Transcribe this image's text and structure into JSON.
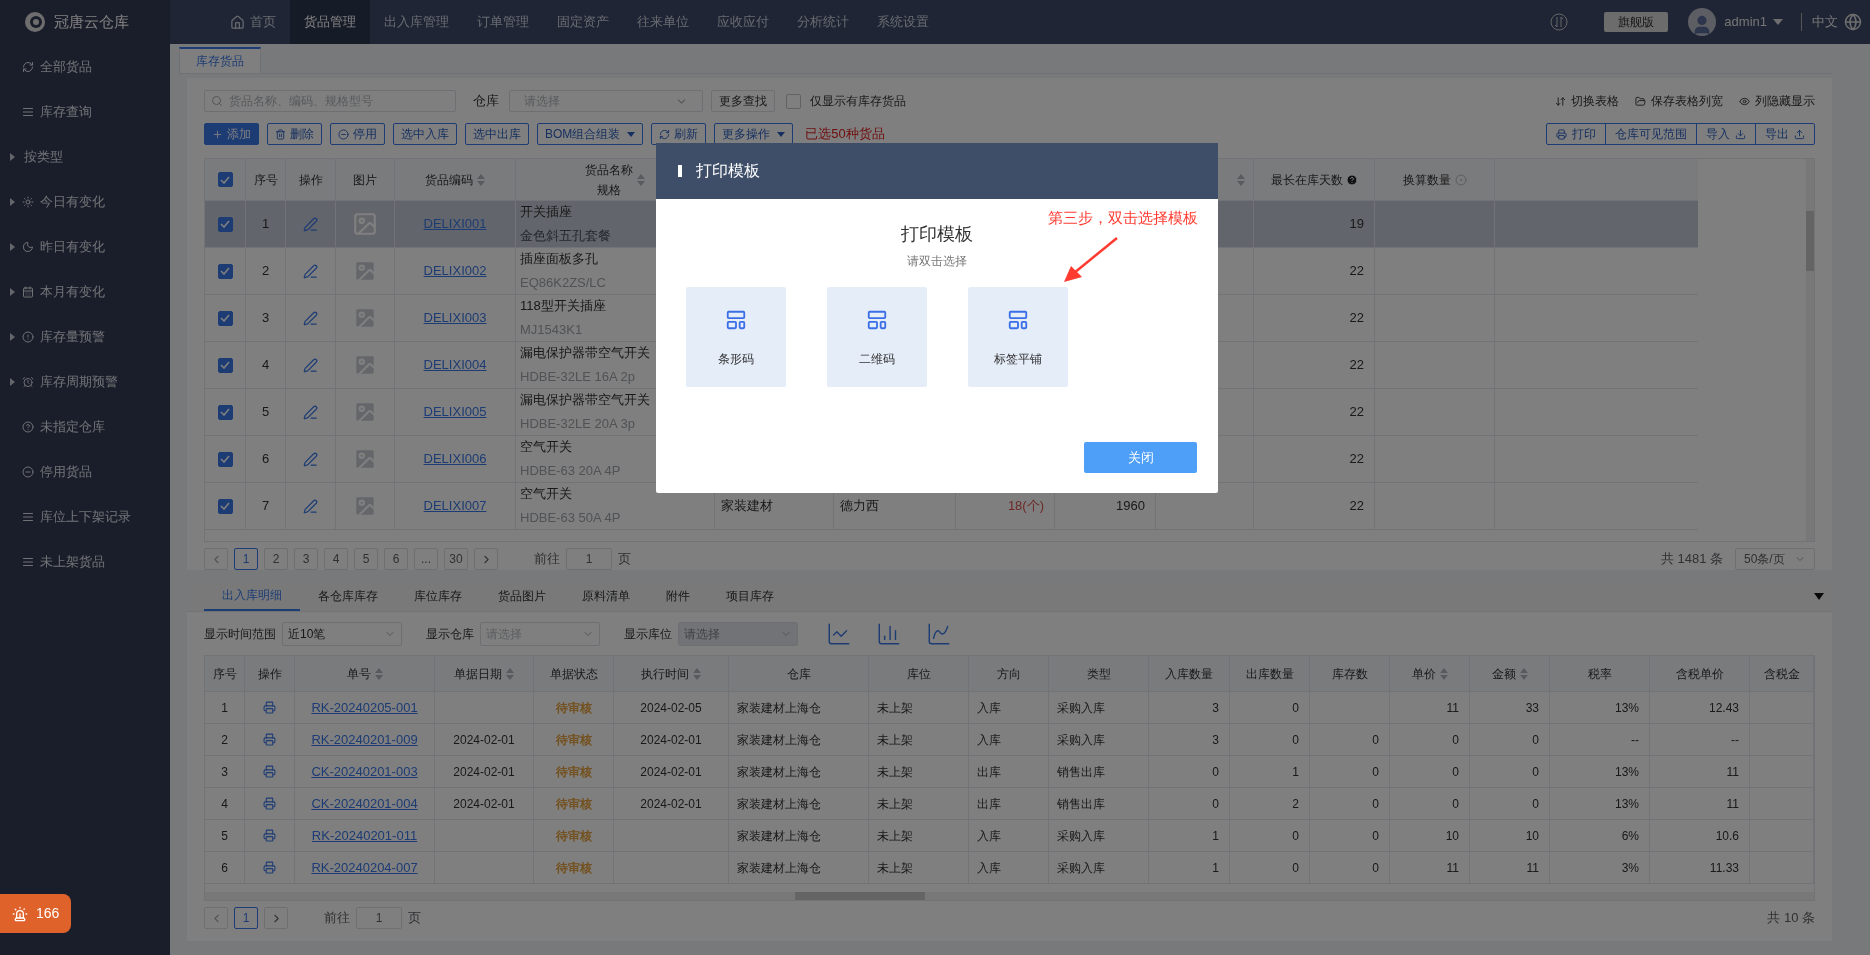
{
  "top_nav": {
    "logo": "冠唐云仓库",
    "items": [
      {
        "label": "首页",
        "selected": false
      },
      {
        "label": "货品管理",
        "selected": true
      },
      {
        "label": "出入库管理",
        "selected": false
      },
      {
        "label": "订单管理",
        "selected": false
      },
      {
        "label": "固定资产",
        "selected": false
      },
      {
        "label": "往来单位",
        "selected": false
      },
      {
        "label": "应收应付",
        "selected": false
      },
      {
        "label": "分析统计",
        "selected": false
      },
      {
        "label": "系统设置",
        "selected": false
      }
    ],
    "edition": "旗舰版",
    "user": "admin1",
    "language": "中文"
  },
  "sidebar": {
    "items": [
      {
        "label": "全部货品",
        "expandable": false
      },
      {
        "label": "库存查询",
        "expandable": false
      },
      {
        "label": "按类型",
        "expandable": true
      },
      {
        "label": "今日有变化",
        "expandable": true
      },
      {
        "label": "昨日有变化",
        "expandable": true
      },
      {
        "label": "本月有变化",
        "expandable": true
      },
      {
        "label": "库存量预警",
        "expandable": true
      },
      {
        "label": "库存周期预警",
        "expandable": true
      },
      {
        "label": "未指定仓库",
        "expandable": false
      },
      {
        "label": "停用货品",
        "expandable": false
      },
      {
        "label": "库位上下架记录",
        "expandable": false
      },
      {
        "label": "未上架货品",
        "expandable": false
      }
    ],
    "alert_count": "166"
  },
  "page_tabs": [
    {
      "label": "库存货品",
      "selected": true
    }
  ],
  "filters": {
    "search_placeholder": "货品名称、编码、规格型号",
    "warehouse_label": "仓库",
    "warehouse_placeholder": "请选择",
    "more_search": "更多查找",
    "in_stock_only": {
      "label": "仅显示有库存货品",
      "checked": false
    },
    "view_links": [
      "切换表格",
      "保存表格列宽",
      "列隐藏显示"
    ]
  },
  "toolbar": {
    "buttons": [
      {
        "label": "添加",
        "kind": "primary"
      },
      {
        "label": "删除",
        "kind": "delete"
      },
      {
        "label": "停用",
        "kind": "disable"
      },
      {
        "label": "选中入库",
        "kind": "plain"
      },
      {
        "label": "选中出库",
        "kind": "plain"
      },
      {
        "label": "BOM组合组装",
        "kind": "dropdown"
      },
      {
        "label": "刷新",
        "kind": "refresh"
      },
      {
        "label": "更多操作",
        "kind": "dropdown"
      }
    ],
    "selection_note": "已选50种货品",
    "right_buttons": [
      {
        "label": "打印",
        "kind": "print"
      },
      {
        "label": "仓库可见范围",
        "kind": "plain"
      },
      {
        "label": "导入",
        "kind": "import"
      },
      {
        "label": "导出",
        "kind": "export"
      }
    ]
  },
  "goods_table": {
    "header_checked": true,
    "columns": [
      {
        "kind": "checkbox",
        "sortable": false
      },
      {
        "label": "序号",
        "sortable": false
      },
      {
        "label": "操作",
        "sortable": false
      },
      {
        "label": "图片",
        "sortable": false
      },
      {
        "label": "货品编码",
        "sortable": true
      },
      {
        "label": "货品名称",
        "sub_label": "规格",
        "sortable": true
      },
      {},
      {},
      {},
      {},
      {
        "sortable": true
      },
      {
        "label": "最长在库天数",
        "kind": "help",
        "sortable": false
      },
      {
        "label": "换算数量",
        "kind": "info",
        "sortable": false
      }
    ],
    "rows": [
      {
        "selected": true,
        "checked": true,
        "no": "1",
        "code": "DELIXI001",
        "name": "开关插座",
        "spec": "金色斜五孔套餐",
        "days": "19"
      },
      {
        "selected": false,
        "checked": true,
        "no": "2",
        "code": "DELIXI002",
        "name": "插座面板多孔",
        "spec": "EQ86K2ZS/LC",
        "days": "22"
      },
      {
        "selected": false,
        "checked": true,
        "no": "3",
        "code": "DELIXI003",
        "name": "118型开关插座",
        "spec": "MJ1543K1",
        "days": "22"
      },
      {
        "selected": false,
        "checked": true,
        "no": "4",
        "code": "DELIXI004",
        "name": "漏电保护器带空气开关",
        "spec": "HDBE-32LE 16A 2p",
        "days": "22"
      },
      {
        "selected": false,
        "checked": true,
        "no": "5",
        "code": "DELIXI005",
        "name": "漏电保护器带空气开关",
        "spec": "HDBE-32LE 20A 3p",
        "days": "22"
      },
      {
        "selected": false,
        "checked": true,
        "no": "6",
        "code": "DELIXI006",
        "name": "空气开关",
        "spec": "HDBE-63 20A 4P",
        "days": "22"
      },
      {
        "selected": false,
        "checked": true,
        "no": "7",
        "code": "DELIXI007",
        "name": "空气开关",
        "spec": "HDBE-63 50A 4P",
        "category": "家装建材",
        "brand": "德力西",
        "stock": "18(个)",
        "count": "1960",
        "days": "22"
      }
    ]
  },
  "pagination": {
    "pages": [
      {
        "label": "1",
        "selected": true
      },
      {
        "label": "2",
        "selected": false
      },
      {
        "label": "3",
        "selected": false
      },
      {
        "label": "4",
        "selected": false
      },
      {
        "label": "5",
        "selected": false
      },
      {
        "label": "6",
        "selected": false
      },
      {
        "label": "...",
        "selected": false
      },
      {
        "label": "30",
        "selected": false
      }
    ],
    "goto_label": "前往",
    "goto_value": "1",
    "goto_suffix": "页",
    "total": "共 1481 条",
    "page_size": "50条/页"
  },
  "detail_tabs": [
    {
      "label": "出入库明细",
      "selected": true
    },
    {
      "label": "各仓库库存",
      "selected": false
    },
    {
      "label": "库位库存",
      "selected": false
    },
    {
      "label": "货品图片",
      "selected": false
    },
    {
      "label": "原料清单",
      "selected": false
    },
    {
      "label": "附件",
      "selected": false
    },
    {
      "label": "项目库存",
      "selected": false
    }
  ],
  "detail_filters": [
    {
      "label": "显示时间范围",
      "value": "近10笔",
      "disabled": false
    },
    {
      "label": "显示仓库",
      "placeholder": "请选择",
      "disabled": false
    },
    {
      "label": "显示库位",
      "placeholder": "请选择",
      "disabled": true
    }
  ],
  "detail_table": {
    "columns": [
      {
        "label": "序号",
        "sortable": false
      },
      {
        "label": "操作",
        "sortable": false
      },
      {
        "label": "单号",
        "sortable": true
      },
      {
        "label": "单据日期",
        "sortable": true
      },
      {
        "label": "单据状态",
        "sortable": false
      },
      {
        "label": "执行时间",
        "sortable": true
      },
      {
        "label": "仓库",
        "sortable": false
      },
      {
        "label": "库位",
        "sortable": false
      },
      {
        "label": "方向",
        "sortable": false
      },
      {
        "label": "类型",
        "sortable": false
      },
      {
        "label": "入库数量",
        "sortable": false
      },
      {
        "label": "出库数量",
        "sortable": false
      },
      {
        "label": "库存数",
        "sortable": false
      },
      {
        "label": "单价",
        "sortable": true
      },
      {
        "label": "金额",
        "sortable": true
      },
      {
        "label": "税率",
        "sortable": false
      },
      {
        "label": "含税单价",
        "sortable": false
      },
      {
        "label": "含税金",
        "sortable": false
      }
    ],
    "rows": [
      {
        "no": "1",
        "order": "RK-20240205-001",
        "status": "待审核",
        "exec_time": "2024-02-05",
        "warehouse": "家装建材上海仓",
        "location": "未上架",
        "direction": "入库",
        "type": "采购入库",
        "in_qty": "3",
        "out_qty": "0",
        "price": "11",
        "amount": "33",
        "tax": "13%",
        "tax_price": "12.43"
      },
      {
        "no": "2",
        "order": "RK-20240201-009",
        "date": "2024-02-01",
        "status": "待审核",
        "exec_time": "2024-02-01",
        "warehouse": "家装建材上海仓",
        "location": "未上架",
        "direction": "入库",
        "type": "采购入库",
        "in_qty": "3",
        "out_qty": "0",
        "stock": "0",
        "price": "0",
        "amount": "0",
        "tax": "--",
        "tax_price": "--"
      },
      {
        "no": "3",
        "order": "CK-20240201-003",
        "date": "2024-02-01",
        "status": "待审核",
        "exec_time": "2024-02-01",
        "warehouse": "家装建材上海仓",
        "location": "未上架",
        "direction": "出库",
        "type": "销售出库",
        "in_qty": "0",
        "out_qty": "1",
        "stock": "0",
        "price": "0",
        "amount": "0",
        "tax": "13%",
        "tax_price": "11"
      },
      {
        "no": "4",
        "order": "CK-20240201-004",
        "date": "2024-02-01",
        "status": "待审核",
        "exec_time": "2024-02-01",
        "warehouse": "家装建材上海仓",
        "location": "未上架",
        "direction": "出库",
        "type": "销售出库",
        "in_qty": "0",
        "out_qty": "2",
        "stock": "0",
        "price": "0",
        "amount": "0",
        "tax": "13%",
        "tax_price": "11"
      },
      {
        "no": "5",
        "order": "RK-20240201-011",
        "status": "待审核",
        "warehouse": "家装建材上海仓",
        "location": "未上架",
        "direction": "入库",
        "type": "采购入库",
        "in_qty": "1",
        "out_qty": "0",
        "stock": "0",
        "price": "10",
        "amount": "10",
        "tax": "6%",
        "tax_price": "10.6"
      },
      {
        "no": "6",
        "order": "RK-20240204-007",
        "status": "待审核",
        "warehouse": "家装建材上海仓",
        "location": "未上架",
        "direction": "入库",
        "type": "采购入库",
        "in_qty": "1",
        "out_qty": "0",
        "stock": "0",
        "price": "11",
        "amount": "11",
        "tax": "3%",
        "tax_price": "11.33"
      }
    ]
  },
  "detail_pagination": {
    "pages": [
      {
        "label": "1",
        "selected": true
      }
    ],
    "goto_label": "前往",
    "goto_value": "1",
    "goto_suffix": "页",
    "total": "共 10 条"
  },
  "modal": {
    "title": "打印模板",
    "heading": "打印模板",
    "hint": "请双击选择",
    "templates": [
      {
        "label": "条形码"
      },
      {
        "label": "二维码"
      },
      {
        "label": "标签平铺"
      }
    ],
    "close": "关闭"
  },
  "annotation": "第三步，双击选择模板"
}
